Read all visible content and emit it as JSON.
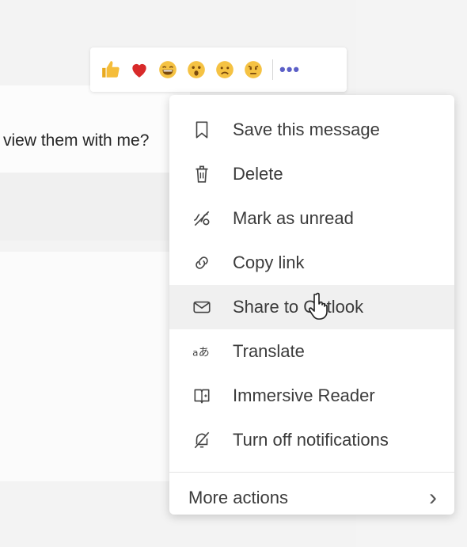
{
  "background": {
    "message_text": "view them with me?"
  },
  "reactions": [
    {
      "name": "like",
      "icon": "thumbs-up-icon",
      "color": "#f2b630"
    },
    {
      "name": "heart",
      "icon": "heart-icon",
      "color": "#d82a2a"
    },
    {
      "name": "laugh",
      "icon": "laugh-icon",
      "color": "#f5c243"
    },
    {
      "name": "surprised",
      "icon": "surprised-icon",
      "color": "#f5c243"
    },
    {
      "name": "sad",
      "icon": "sad-icon",
      "color": "#f5c243"
    },
    {
      "name": "angry",
      "icon": "angry-icon",
      "color": "#f5c243"
    }
  ],
  "reaction_bar": {
    "more_label": "•••"
  },
  "menu": {
    "items": [
      {
        "label": "Save this message",
        "icon": "bookmark-icon"
      },
      {
        "label": "Delete",
        "icon": "trash-icon"
      },
      {
        "label": "Mark as unread",
        "icon": "unread-icon"
      },
      {
        "label": "Copy link",
        "icon": "link-icon"
      },
      {
        "label": "Share to Outlook",
        "icon": "mail-icon"
      },
      {
        "label": "Translate",
        "icon": "translate-icon"
      },
      {
        "label": "Immersive Reader",
        "icon": "immersive-reader-icon"
      },
      {
        "label": "Turn off notifications",
        "icon": "bell-off-icon"
      }
    ],
    "more_actions": "More actions",
    "more_chevron": "›"
  }
}
